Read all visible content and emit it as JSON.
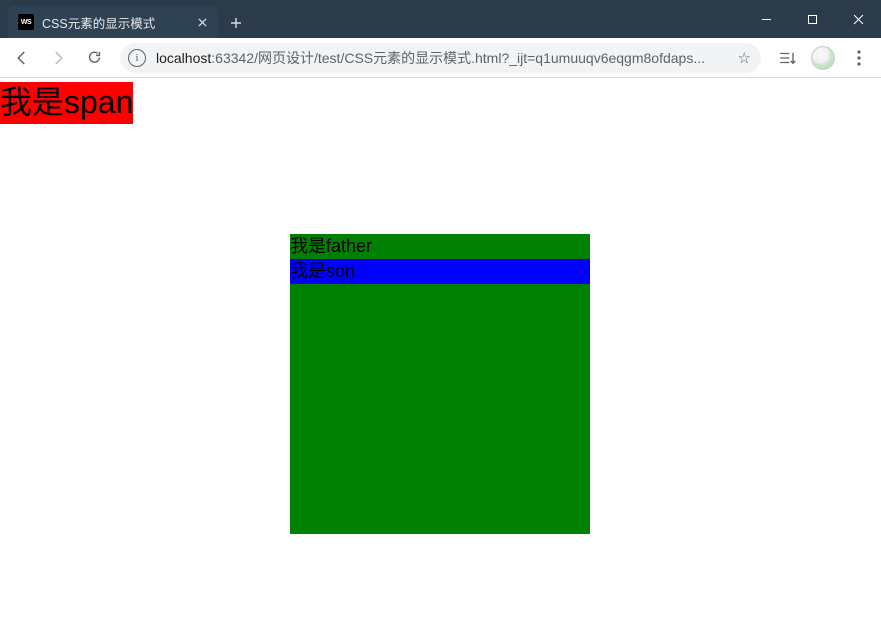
{
  "window": {
    "tab_title": "CSS元素的显示模式",
    "favicon_text": "WS"
  },
  "toolbar": {
    "url_host": "localhost",
    "url_port": ":63342",
    "url_path": "/网页设计/test/CSS元素的显示模式.html?_ijt=q1umuuqv6eqgm8ofdaps..."
  },
  "page": {
    "span_text": "我是span",
    "father_text": "我是father",
    "son_text": "我是son"
  }
}
